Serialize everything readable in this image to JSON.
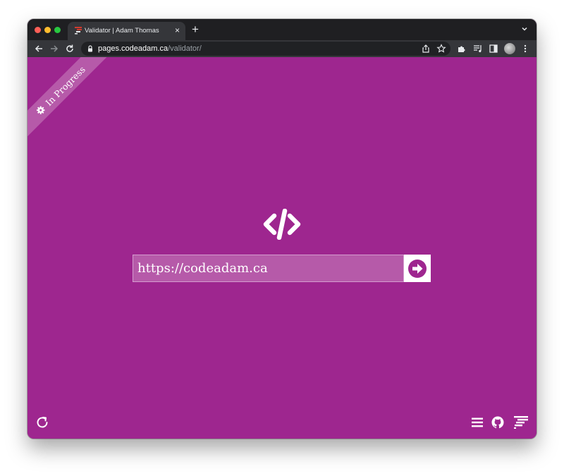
{
  "browser": {
    "tab_title": "Validator | Adam Thomas",
    "new_tab_label": "+",
    "url_host": "pages.codeadam.ca",
    "url_path": "/validator/"
  },
  "page": {
    "ribbon_label": "In Progress",
    "input_value": "https://codeadam.ca",
    "background_color": "#9e268f",
    "icons": {
      "logo": "code-icon",
      "submit": "arrow-circle-right-icon",
      "reload": "refresh-icon",
      "menu": "hamburger-menu-icon",
      "github": "github-icon",
      "brand": "codeadam-logo-icon",
      "ribbon": "gear-icon"
    }
  }
}
